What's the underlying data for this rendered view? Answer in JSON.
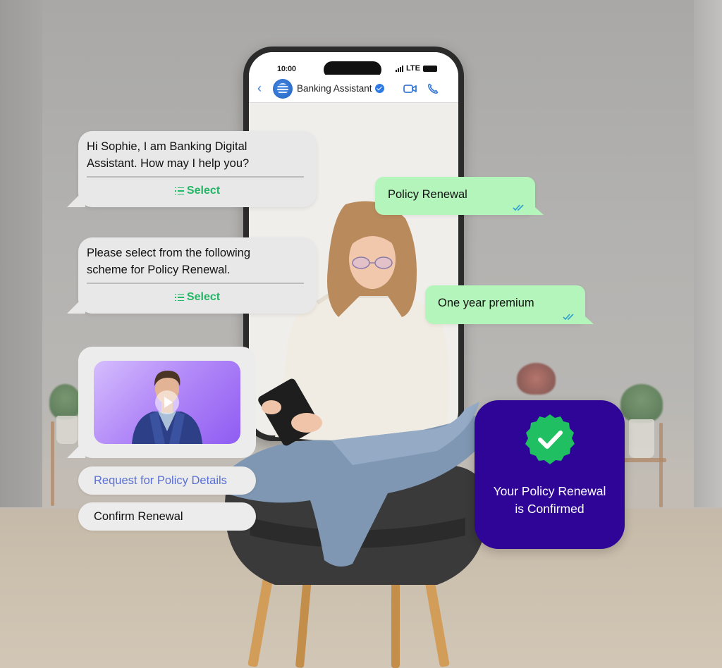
{
  "phone": {
    "status_time": "10:00",
    "network": "LTE",
    "header": {
      "back_icon": "chevron-left-icon",
      "contact_name": "Banking Assistant",
      "verified": true,
      "video_call_icon": "video-camera-icon",
      "voice_call_icon": "phone-icon"
    }
  },
  "messages": [
    {
      "direction": "incoming",
      "text_line1": "Hi Sophie, I am Banking Digital",
      "text_line2": "Assistant. How may I help you?",
      "action_label": "Select",
      "action_icon": "list-icon"
    },
    {
      "direction": "outgoing",
      "text": "Policy Renewal",
      "status": "read"
    },
    {
      "direction": "incoming",
      "text_line1": "Please select from the following",
      "text_line2": "scheme for Policy Renewal.",
      "action_label": "Select",
      "action_icon": "list-icon"
    },
    {
      "direction": "outgoing",
      "text": "One year premium",
      "status": "read"
    },
    {
      "direction": "incoming",
      "type": "video",
      "media_icon": "play-icon"
    }
  ],
  "quick_replies": [
    {
      "label": "Request for Policy Details",
      "style": "link"
    },
    {
      "label": "Confirm Renewal",
      "style": "default"
    }
  ],
  "confirmation": {
    "icon": "verified-check-badge-icon",
    "line1": "Your Policy Renewal",
    "line2": "is Confirmed"
  },
  "colors": {
    "incoming_bubble": "#e8e8e8",
    "outgoing_bubble": "#b4f5bc",
    "select_green": "#25b566",
    "link_blue": "#5a70d6",
    "confirm_card": "#2e0597",
    "badge_green": "#1fbf62",
    "verified_blue": "#2e7be6"
  }
}
